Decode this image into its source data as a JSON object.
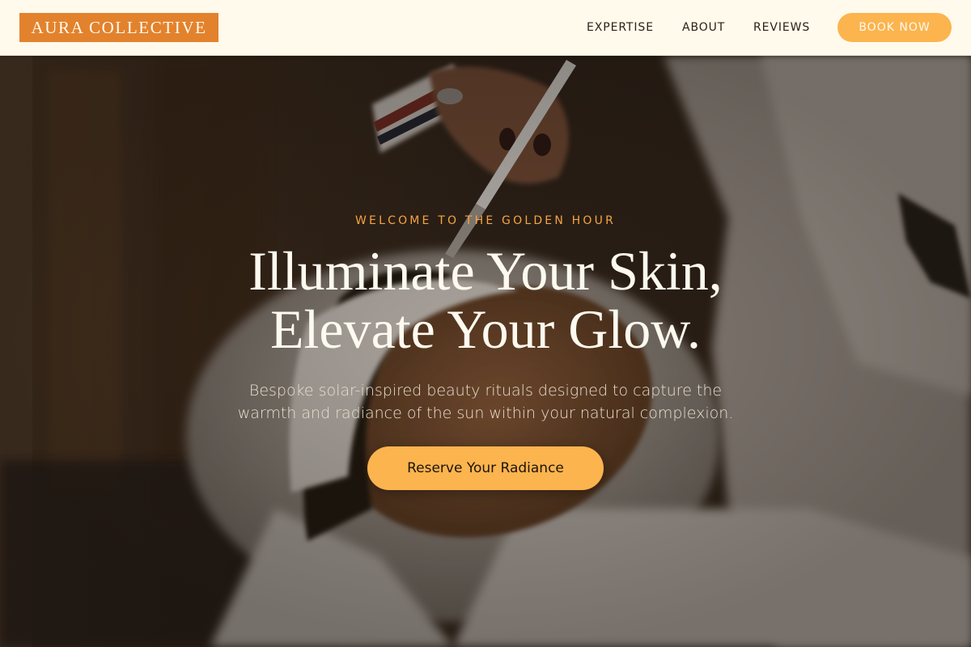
{
  "brand": {
    "logo_text": "AURA COLLECTIVE",
    "accent_color": "#e3822c"
  },
  "nav": {
    "items": [
      {
        "label": "EXPERTISE"
      },
      {
        "label": "ABOUT"
      },
      {
        "label": "REVIEWS"
      }
    ],
    "cta_label": "BOOK NOW",
    "cta_color": "#fcb44e"
  },
  "hero": {
    "eyebrow": "WELCOME TO THE GOLDEN HOUR",
    "headline_line1": "Illuminate Your Skin,",
    "headline_line2": "Elevate Your Glow.",
    "subtext": "Bespoke solar-inspired beauty rituals designed to capture the warmth and radiance of the sun within your natural complexion.",
    "cta_label": "Reserve Your Radiance",
    "eyebrow_color": "#f5a443",
    "background_image": "facial-treatment-photo"
  }
}
